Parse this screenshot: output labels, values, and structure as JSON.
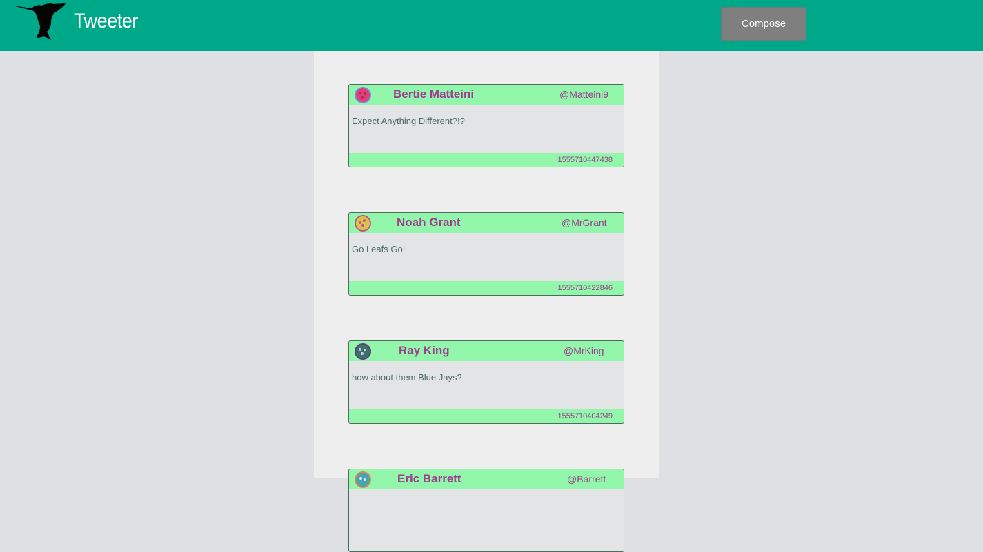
{
  "header": {
    "brand": "Tweeter",
    "compose_label": "Compose",
    "logo_icon": "hummingbird-icon",
    "color": "#00a88a"
  },
  "tweets": [
    {
      "name": "Bertie Matteini",
      "handle": "@Matteini9",
      "text": "Expect Anything Different?!?",
      "timestamp": "1555710447438",
      "avatar_icon": "avatar-icon",
      "avatar_color": "#e0407a"
    },
    {
      "name": "Noah Grant",
      "handle": "@MrGrant",
      "text": "Go Leafs Go!",
      "timestamp": "1555710422846",
      "avatar_icon": "avatar-icon",
      "avatar_color": "#d9c34a"
    },
    {
      "name": "Ray King",
      "handle": "@MrKing",
      "text": "how about them Blue Jays?",
      "timestamp": "1555710404249",
      "avatar_icon": "avatar-icon",
      "avatar_color": "#3f6f6a"
    },
    {
      "name": "Eric Barrett",
      "handle": "@Barrett",
      "text": "",
      "timestamp": "",
      "avatar_icon": "avatar-icon",
      "avatar_color": "#4aa3b3"
    }
  ],
  "colors": {
    "header_bg": "#00a88a",
    "tweet_band": "#93f7ab",
    "accent_text": "#9d3d91",
    "body_text": "#4e6a63",
    "page_bg": "#dfe0e3",
    "feed_bg": "#eeeeee",
    "compose_bg": "#7f7f7f"
  }
}
